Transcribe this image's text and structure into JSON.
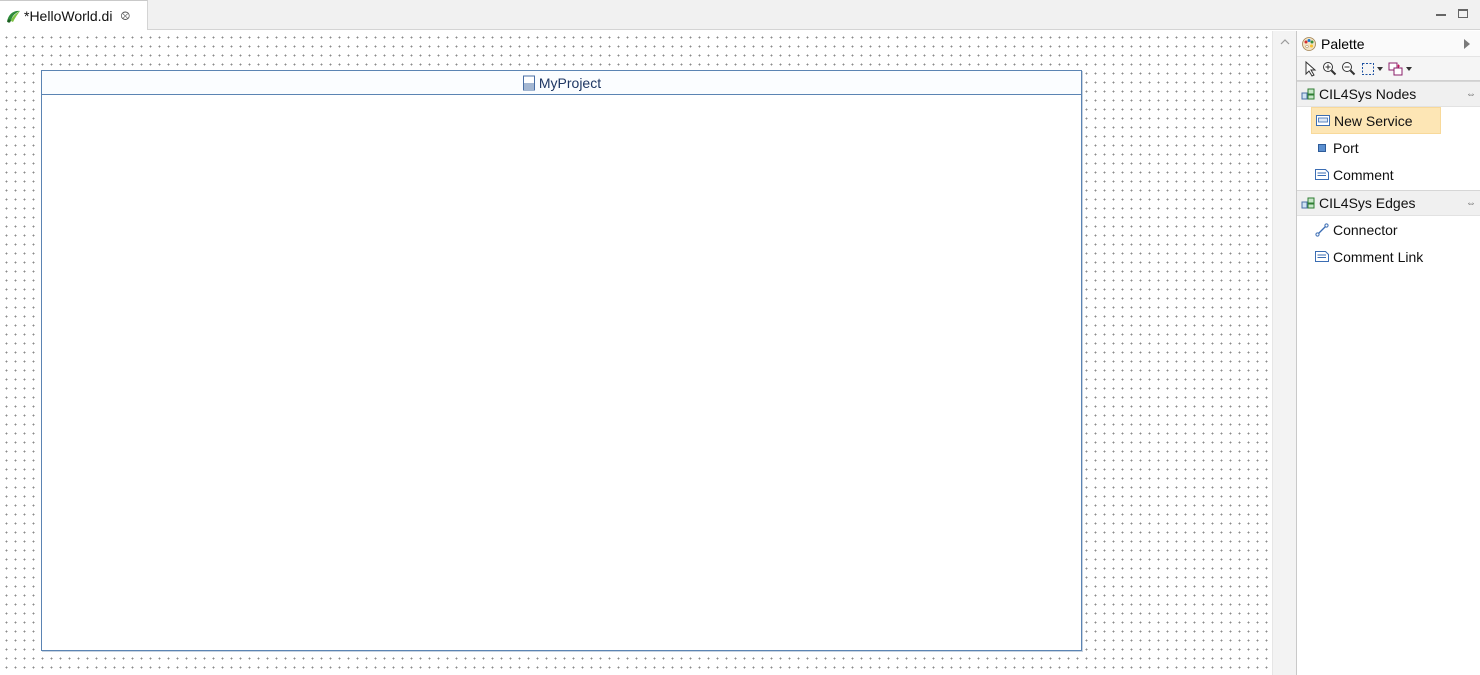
{
  "editor": {
    "tab_label": "*HelloWorld.di",
    "tab_icon": "papyrus-di-icon"
  },
  "window_controls": [
    "minimize-icon",
    "maximize-icon"
  ],
  "diagram": {
    "node_title": "MyProject",
    "node_icon": "model-icon",
    "grid": true
  },
  "palette": {
    "title": "Palette",
    "tools": [
      "select-pointer-icon",
      "zoom-in-icon",
      "zoom-out-icon",
      "marquee-select-icon",
      "note-attachment-icon"
    ],
    "drawers": [
      {
        "label": "CIL4Sys Nodes",
        "entries": [
          {
            "label": "New Service",
            "icon": "service-icon",
            "selected": true
          },
          {
            "label": "Port",
            "icon": "port-icon",
            "selected": false
          },
          {
            "label": "Comment",
            "icon": "comment-icon",
            "selected": false
          }
        ]
      },
      {
        "label": "CIL4Sys Edges",
        "entries": [
          {
            "label": "Connector",
            "icon": "connector-icon",
            "selected": false
          },
          {
            "label": "Comment Link",
            "icon": "comment-link-icon",
            "selected": false
          }
        ]
      }
    ]
  },
  "colors": {
    "node_border": "#5b84b3",
    "selection": "#fde6b5"
  }
}
